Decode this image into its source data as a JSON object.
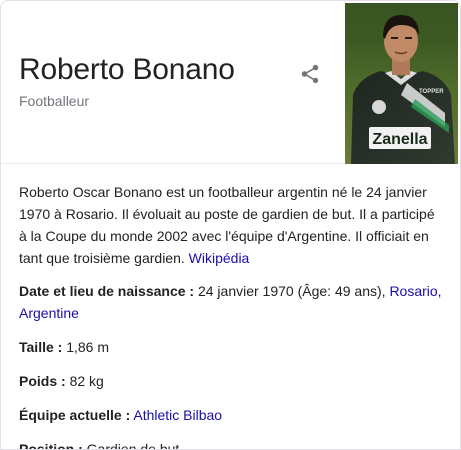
{
  "header": {
    "title": "Roberto Bonano",
    "subtitle": "Footballeur",
    "share_icon": "share-icon",
    "photo_jersey_text": "Zanella",
    "photo_badge_text": "TOPPER"
  },
  "description": {
    "text": "Roberto Oscar Bonano est un footballeur argentin né le 24 janvier 1970 à Rosario. Il évoluait au poste de gardien de but. Il a participé à la Coupe du monde 2002 avec l'équipe d'Argentine. Il officiait en tant que troisième gardien.",
    "source_link": "Wikipédia"
  },
  "facts": {
    "birth": {
      "label": "Date et lieu de naissance :",
      "value": "24 janvier 1970 (Âge: 49 ans),",
      "link1": "Rosario,",
      "link2": "Argentine"
    },
    "height": {
      "label": "Taille :",
      "value": "1,86 m"
    },
    "weight": {
      "label": "Poids :",
      "value": "82 kg"
    },
    "team": {
      "label": "Équipe actuelle :",
      "link": "Athletic Bilbao"
    },
    "position": {
      "label": "Position :",
      "value": "Gardien de but"
    }
  },
  "colors": {
    "link": "#1a0dab",
    "muted": "#70757a",
    "text": "#222222",
    "border": "#dfe1e5"
  }
}
